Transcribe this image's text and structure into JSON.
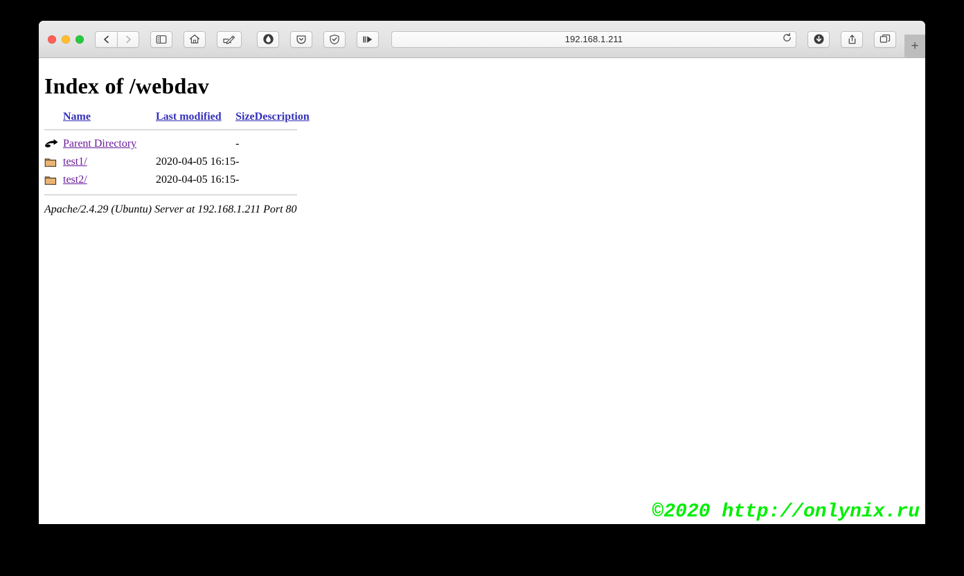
{
  "window": {
    "traffic_lights": [
      {
        "name": "close",
        "color": "#ff5f57"
      },
      {
        "name": "minimize",
        "color": "#ffbd2e"
      },
      {
        "name": "zoom",
        "color": "#28c840"
      }
    ]
  },
  "toolbar": {
    "back": "back-icon",
    "forward": "forward-icon",
    "sidebar": "sidebar-icon",
    "home": "home-icon",
    "markup": "markup-edit-icon",
    "extension_adblock": "adblock-icon",
    "extension_pocket": "pocket-icon",
    "extension_shield": "shield-check-icon",
    "extension_skip": "skip-forward-icon",
    "reload": "reload-icon",
    "downloads": "download-icon",
    "share": "share-icon",
    "tab_overview": "tab-overview-icon",
    "new_tab_label": "+"
  },
  "url_bar": {
    "value": "192.168.1.211",
    "placeholder": "Search or enter website name"
  },
  "page": {
    "title": "Index of /webdav",
    "columns": [
      {
        "key": "name",
        "label": "Name"
      },
      {
        "key": "modified",
        "label": "Last modified"
      },
      {
        "key": "size",
        "label": "Size"
      },
      {
        "key": "description",
        "label": "Description"
      }
    ],
    "rows": [
      {
        "icon": "parent-directory-icon",
        "name": "Parent Directory",
        "modified": "",
        "size": "-",
        "description": ""
      },
      {
        "icon": "folder-icon",
        "name": "test1/",
        "modified": "2020-04-05 16:15",
        "size": "-",
        "description": ""
      },
      {
        "icon": "folder-icon",
        "name": "test2/",
        "modified": "2020-04-05 16:15",
        "size": "-",
        "description": ""
      }
    ],
    "server_signature": "Apache/2.4.29 (Ubuntu) Server at 192.168.1.211 Port 80",
    "watermark": "©2020 http://onlynix.ru"
  },
  "colors": {
    "link_visited": "#6a1a9a",
    "header_link": "#3531b8",
    "watermark": "#00ee00",
    "folder": "#e9b474",
    "desktop": "#000000",
    "toolbar": "#e6e6e6"
  }
}
